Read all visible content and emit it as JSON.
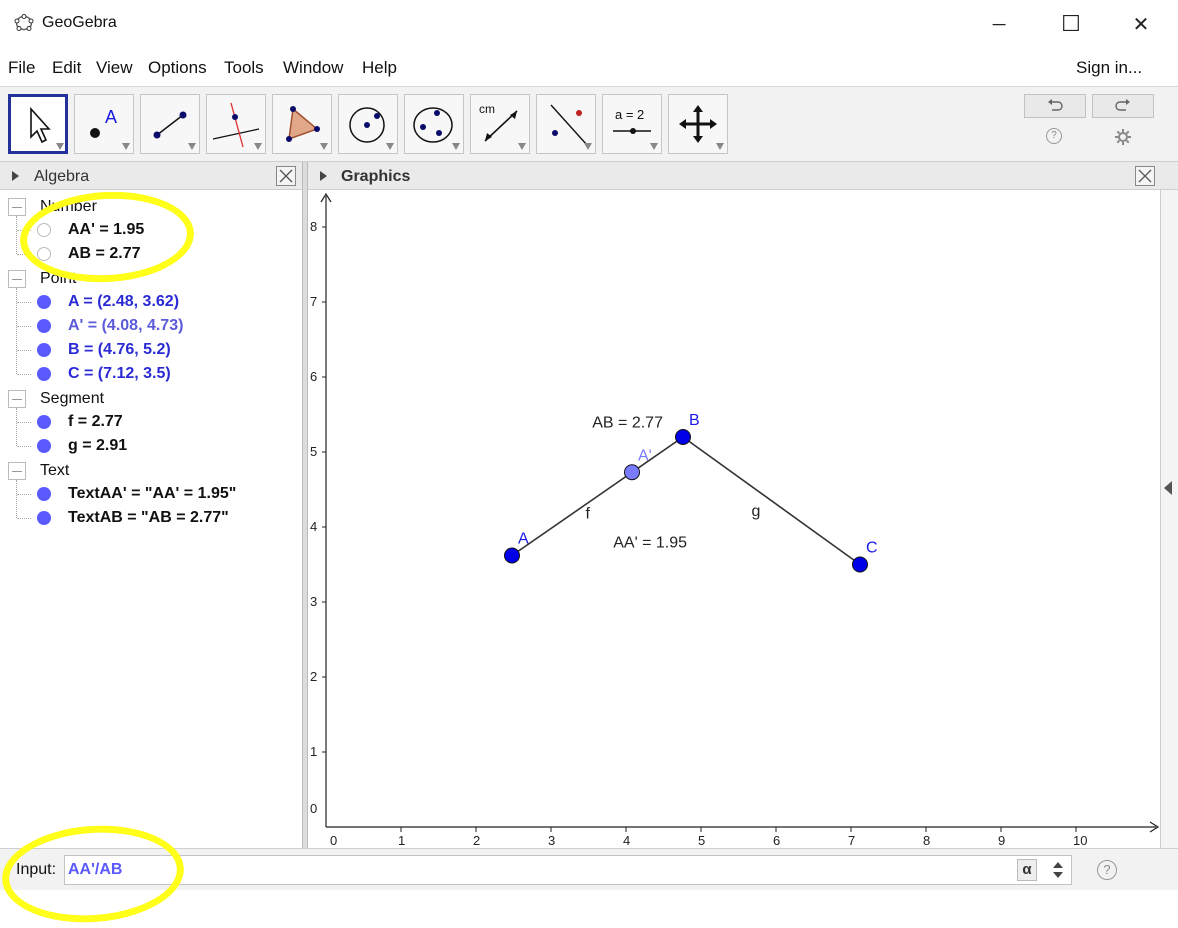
{
  "window": {
    "title": "GeoGebra",
    "minimize_glyph": "─",
    "maximize_glyph": "☐",
    "close_glyph": "✕"
  },
  "menu": {
    "items": [
      "File",
      "Edit",
      "View",
      "Options",
      "Tools",
      "Window",
      "Help"
    ],
    "sign_in": "Sign in..."
  },
  "toolbar": {
    "tools": [
      {
        "icon": "move-icon",
        "selected": true
      },
      {
        "icon": "point-icon",
        "label": "A"
      },
      {
        "icon": "line-icon"
      },
      {
        "icon": "perpendicular-line-icon"
      },
      {
        "icon": "polygon-icon"
      },
      {
        "icon": "circle-icon"
      },
      {
        "icon": "conic-icon"
      },
      {
        "icon": "distance-icon",
        "label": "cm"
      },
      {
        "icon": "reflect-icon"
      },
      {
        "icon": "slider-icon",
        "label": "a = 2"
      },
      {
        "icon": "move-view-icon"
      }
    ],
    "undo_icon": "undo-icon",
    "redo_icon": "redo-icon",
    "help_glyph": "?",
    "settings_icon": "gear-icon"
  },
  "algebra": {
    "title": "Algebra",
    "groups": [
      {
        "label": "Number",
        "items": [
          {
            "text": "AA' = 1.95",
            "color": "#111111",
            "dot": "hollow"
          },
          {
            "text": "AB = 2.77",
            "color": "#111111",
            "dot": "hollow"
          }
        ]
      },
      {
        "label": "Point",
        "items": [
          {
            "text": "A = (2.48, 3.62)",
            "color": "#2b2bd6",
            "dot": "#5a5aff"
          },
          {
            "text": "A' = (4.08, 4.73)",
            "color": "#5b5bdb",
            "dot": "#5a5aff"
          },
          {
            "text": "B = (4.76, 5.2)",
            "color": "#2b2bd6",
            "dot": "#5a5aff"
          },
          {
            "text": "C = (7.12, 3.5)",
            "color": "#2b2bd6",
            "dot": "#5a5aff"
          }
        ]
      },
      {
        "label": "Segment",
        "items": [
          {
            "text": "f = 2.77",
            "color": "#111111",
            "dot": "#5a5aff"
          },
          {
            "text": "g = 2.91",
            "color": "#111111",
            "dot": "#5a5aff"
          }
        ]
      },
      {
        "label": "Text",
        "items": [
          {
            "text": "TextAA' = \"AA' = 1.95\"",
            "color": "#111111",
            "dot": "#5a5aff"
          },
          {
            "text": "TextAB = \"AB = 2.77\"",
            "color": "#111111",
            "dot": "#5a5aff"
          }
        ]
      }
    ]
  },
  "graphics": {
    "title": "Graphics",
    "x_ticks": [
      "0",
      "1",
      "2",
      "3",
      "4",
      "5",
      "6",
      "7",
      "8",
      "9",
      "10"
    ],
    "y_ticks": [
      "0",
      "1",
      "2",
      "3",
      "4",
      "5",
      "6",
      "7",
      "8"
    ],
    "points": [
      {
        "name": "A",
        "x": 2.48,
        "y": 3.62,
        "color": "#0000e6"
      },
      {
        "name": "A'",
        "x": 4.08,
        "y": 4.73,
        "color": "#7a7aff"
      },
      {
        "name": "B",
        "x": 4.76,
        "y": 5.2,
        "color": "#0000e6"
      },
      {
        "name": "C",
        "x": 7.12,
        "y": 3.5,
        "color": "#0000e6"
      }
    ],
    "segments": [
      {
        "name": "f",
        "from": "A",
        "to": "B"
      },
      {
        "name": "g",
        "from": "B",
        "to": "C"
      }
    ],
    "texts": [
      {
        "text": "AB = 2.77",
        "x": 3.55,
        "y": 5.33
      },
      {
        "text": "AA' = 1.95",
        "x": 3.83,
        "y": 3.73
      }
    ]
  },
  "input": {
    "label": "Input:",
    "value": "AA'/AB",
    "alpha_glyph": "α",
    "help_glyph": "?"
  },
  "accent": "#23319b",
  "highlight_color": "#ffff1a"
}
